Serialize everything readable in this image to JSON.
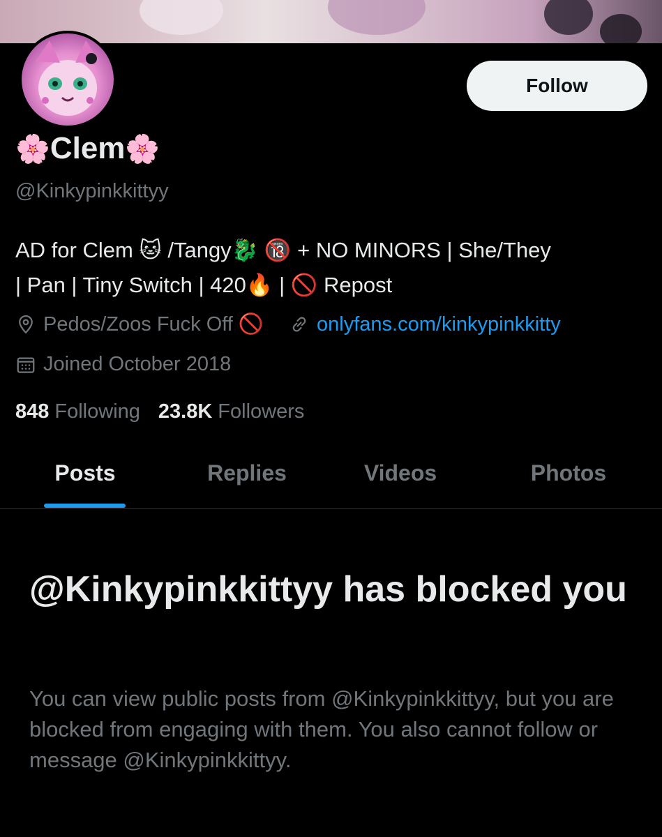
{
  "profile": {
    "display_name": "Clem",
    "name_emoji": "🌸",
    "handle": "@Kinkypinkkittyy",
    "bio_line1": "AD for Clem 🐱 /Tangy🐉  🔞 + NO MINORS | She/They",
    "bio_line2": "| Pan | Tiny Switch | 420🔥 | 🚫 Repost",
    "location": "Pedos/Zoos Fuck Off 🚫",
    "website": "onlyfans.com/kinkypinkkitty",
    "joined": "Joined October 2018",
    "following_count": "848",
    "following_label": "Following",
    "followers_count": "23.8K",
    "followers_label": "Followers",
    "follow_button": "Follow"
  },
  "tabs": [
    "Posts",
    "Replies",
    "Videos",
    "Photos"
  ],
  "active_tab": "Posts",
  "blocked": {
    "title": "@Kinkypinkkittyy has blocked you",
    "body": "You can view public posts from @Kinkypinkkittyy, but you are blocked from engaging with them. You also cannot follow or message @Kinkypinkkittyy."
  },
  "colors": {
    "background": "#000000",
    "text_primary": "#e7e9ea",
    "text_secondary": "#71767b",
    "accent": "#1d9bf0",
    "button_bg": "#eff3f4"
  },
  "icons": {
    "location": "location-pin-icon",
    "website": "link-icon",
    "joined": "calendar-icon"
  }
}
